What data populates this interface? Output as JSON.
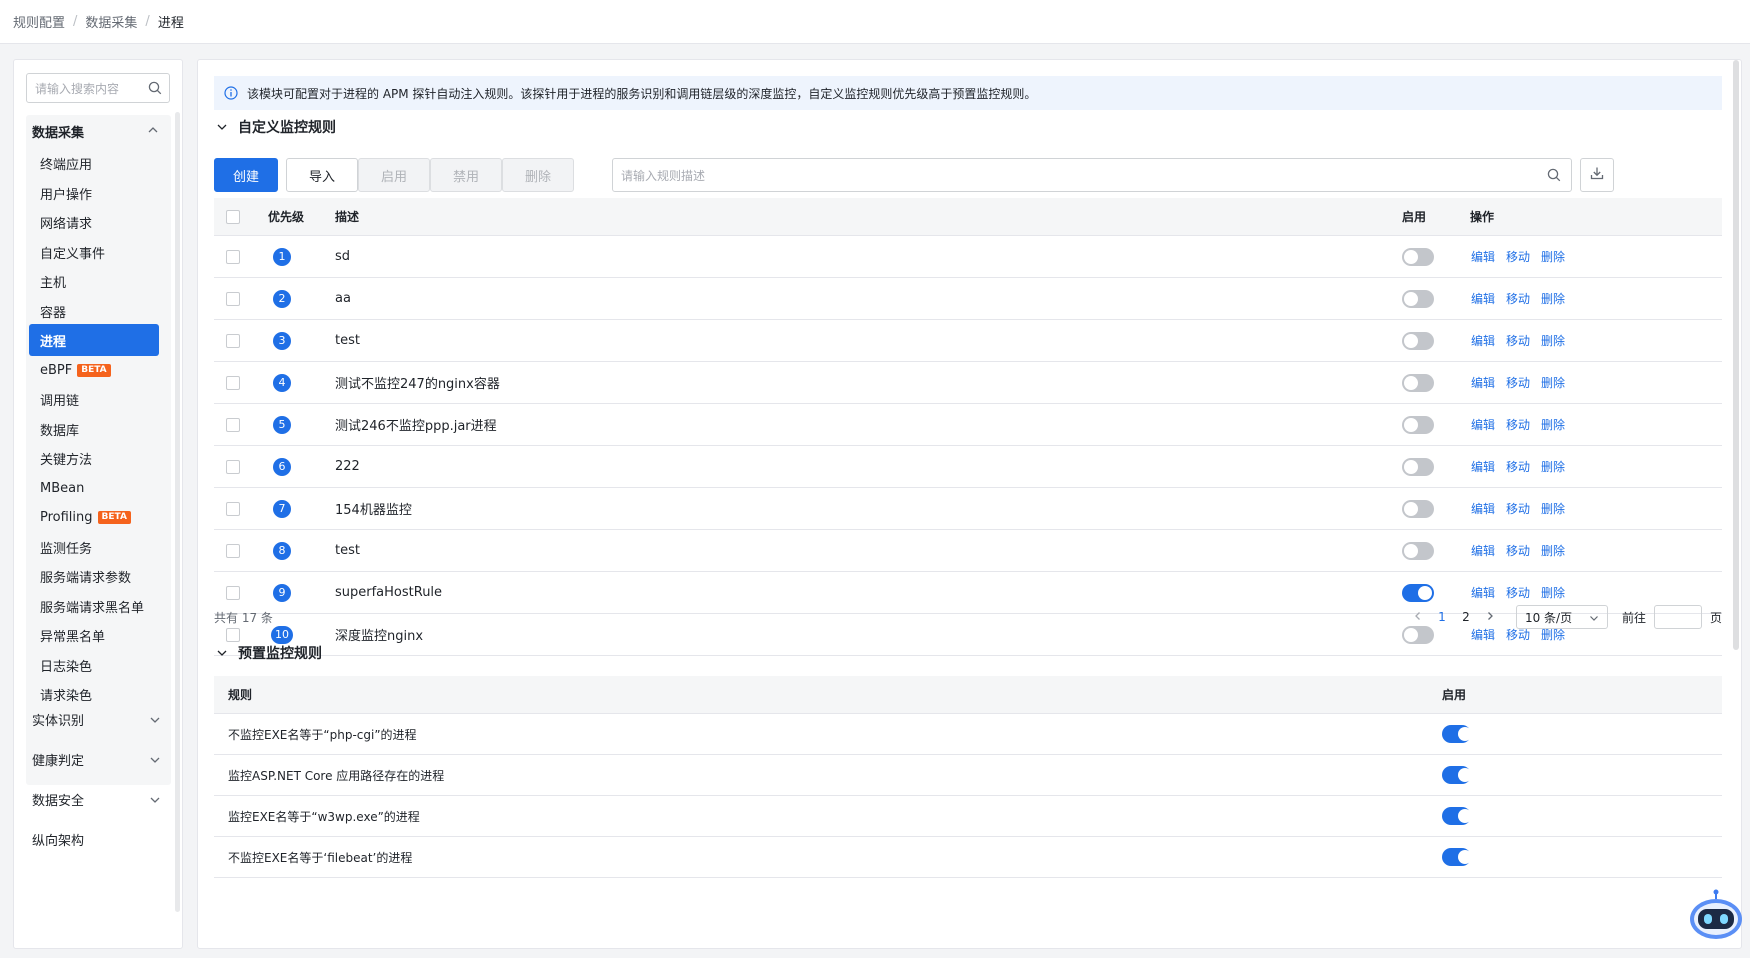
{
  "breadcrumb": [
    "规则配置",
    "数据采集",
    "进程"
  ],
  "sidebar": {
    "search_placeholder": "请输入搜索内容",
    "group_title": "数据采集",
    "items": [
      {
        "label": "终端应用"
      },
      {
        "label": "用户操作"
      },
      {
        "label": "网络请求"
      },
      {
        "label": "自定义事件"
      },
      {
        "label": "主机"
      },
      {
        "label": "容器"
      },
      {
        "label": "进程",
        "active": true
      },
      {
        "label": "eBPF",
        "badge": "BETA"
      },
      {
        "label": "调用链"
      },
      {
        "label": "数据库"
      },
      {
        "label": "关键方法"
      },
      {
        "label": "MBean"
      },
      {
        "label": "Profiling",
        "badge": "BETA"
      },
      {
        "label": "监测任务"
      },
      {
        "label": "服务端请求参数"
      },
      {
        "label": "服务端请求黑名单"
      },
      {
        "label": "异常黑名单"
      },
      {
        "label": "日志染色"
      },
      {
        "label": "请求染色"
      }
    ],
    "collapsed_groups": [
      "实体识别",
      "健康判定",
      "数据安全",
      "纵向架构"
    ]
  },
  "info": "该模块可配置对于进程的 APM 探针自动注入规则。该探针用于进程的服务识别和调用链层级的深度监控，自定义监控规则优先级高于预置监控规则。",
  "custom_section": {
    "title": "自定义监控规则",
    "buttons": {
      "create": "创建",
      "import": "导入",
      "enable": "启用",
      "disable": "禁用",
      "delete": "删除"
    },
    "search_placeholder": "请输入规则描述",
    "columns": {
      "priority": "优先级",
      "description": "描述",
      "enabled": "启用",
      "actions": "操作"
    },
    "action_labels": {
      "edit": "编辑",
      "move": "移动",
      "delete": "删除"
    },
    "rows": [
      {
        "priority": "1",
        "description": "sd",
        "enabled": false
      },
      {
        "priority": "2",
        "description": "aa",
        "enabled": false
      },
      {
        "priority": "3",
        "description": "test",
        "enabled": false
      },
      {
        "priority": "4",
        "description": "测试不监控247的nginx容器",
        "enabled": false
      },
      {
        "priority": "5",
        "description": "测试246不监控ppp.jar进程",
        "enabled": false
      },
      {
        "priority": "6",
        "description": "222",
        "enabled": false
      },
      {
        "priority": "7",
        "description": "154机器监控",
        "enabled": false
      },
      {
        "priority": "8",
        "description": "test",
        "enabled": false
      },
      {
        "priority": "9",
        "description": "superfaHostRule",
        "enabled": true
      },
      {
        "priority": "10",
        "description": "深度监控nginx",
        "enabled": false
      }
    ],
    "total": "共有 17 条",
    "pagination": {
      "pages": [
        "1",
        "2"
      ],
      "current": "1",
      "page_size": "10 条/页",
      "goto_label": "前往",
      "goto_suffix": "页"
    }
  },
  "preset_section": {
    "title": "预置监控规则",
    "columns": {
      "rule": "规则",
      "enabled": "启用"
    },
    "rows": [
      {
        "rule": "不监控EXE名等于“php-cgi”的进程",
        "enabled": true
      },
      {
        "rule": "监控ASP.NET Core 应用路径存在的进程",
        "enabled": true
      },
      {
        "rule": "监控EXE名等于“w3wp.exe”的进程",
        "enabled": true
      },
      {
        "rule": "不监控EXE名等于‘filebeat’的进程",
        "enabled": true
      }
    ]
  },
  "colors": {
    "primary": "#1f6fe6",
    "beta": "#f5631d"
  }
}
